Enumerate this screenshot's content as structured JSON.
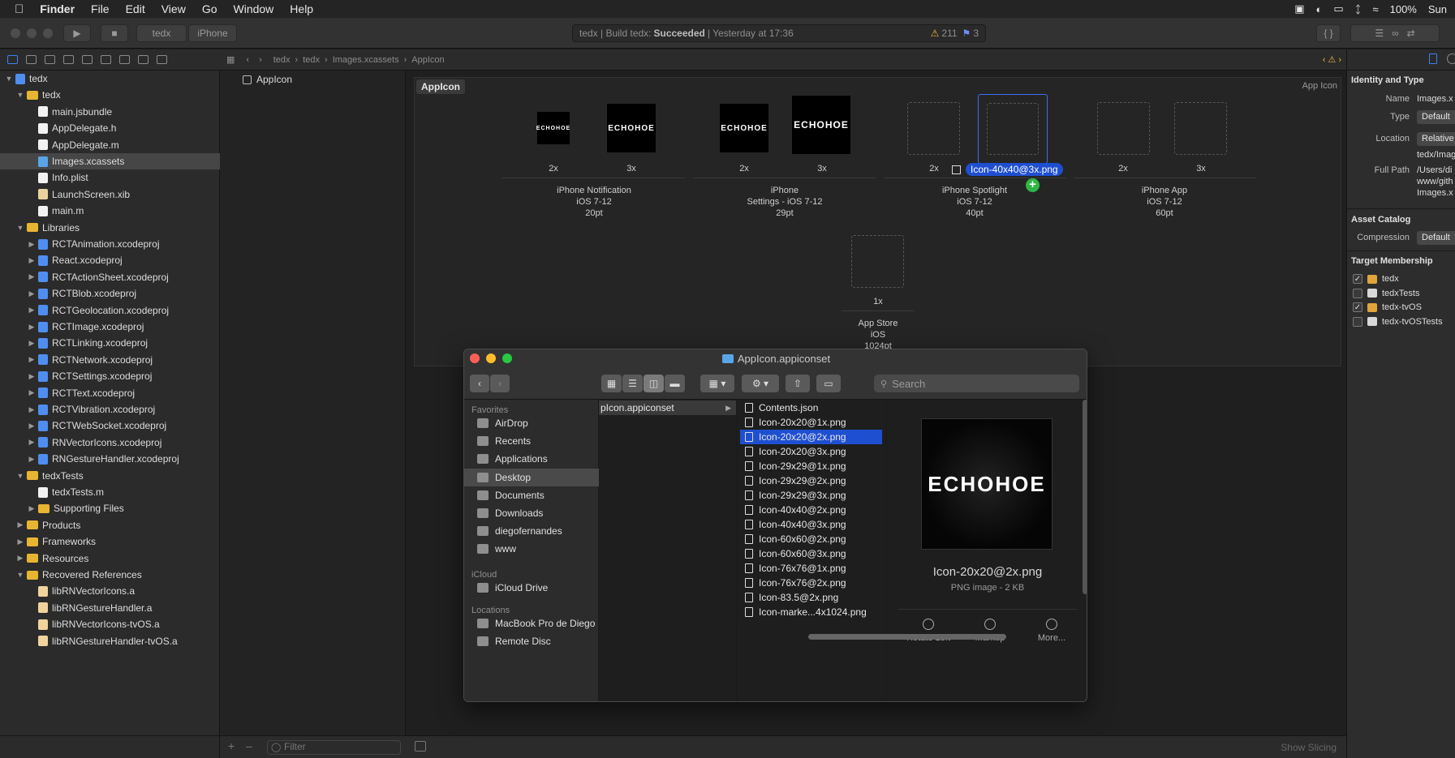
{
  "menubar": {
    "app": "Finder",
    "items": [
      "File",
      "Edit",
      "View",
      "Go",
      "Window",
      "Help"
    ],
    "battery": "100%",
    "clock": "Sun"
  },
  "xcode": {
    "scheme": "tedx",
    "device": "iPhone",
    "activity": {
      "prefix": "tedx | Build tedx:",
      "status": "Succeeded",
      "time": "| Yesterday at 17:36",
      "warnings": "211",
      "issues": "3"
    },
    "jumpbar": [
      "tedx",
      "tedx",
      "Images.xcassets",
      "AppIcon"
    ],
    "navigator": [
      {
        "label": "tedx",
        "indent": 0,
        "tri": "▼",
        "icon": "proj"
      },
      {
        "label": "tedx",
        "indent": 1,
        "tri": "▼",
        "icon": "folder"
      },
      {
        "label": "main.jsbundle",
        "indent": 2,
        "tri": "",
        "icon": "file"
      },
      {
        "label": "AppDelegate.h",
        "indent": 2,
        "tri": "",
        "icon": "file"
      },
      {
        "label": "AppDelegate.m",
        "indent": 2,
        "tri": "",
        "icon": "file"
      },
      {
        "label": "Images.xcassets",
        "indent": 2,
        "tri": "",
        "icon": "asset",
        "sel": true
      },
      {
        "label": "Info.plist",
        "indent": 2,
        "tri": "",
        "icon": "plist"
      },
      {
        "label": "LaunchScreen.xib",
        "indent": 2,
        "tri": "",
        "icon": "xib"
      },
      {
        "label": "main.m",
        "indent": 2,
        "tri": "",
        "icon": "file"
      },
      {
        "label": "Libraries",
        "indent": 1,
        "tri": "▼",
        "icon": "folder"
      },
      {
        "label": "RCTAnimation.xcodeproj",
        "indent": 2,
        "tri": "▶",
        "icon": "proj"
      },
      {
        "label": "React.xcodeproj",
        "indent": 2,
        "tri": "▶",
        "icon": "proj"
      },
      {
        "label": "RCTActionSheet.xcodeproj",
        "indent": 2,
        "tri": "▶",
        "icon": "proj"
      },
      {
        "label": "RCTBlob.xcodeproj",
        "indent": 2,
        "tri": "▶",
        "icon": "proj"
      },
      {
        "label": "RCTGeolocation.xcodeproj",
        "indent": 2,
        "tri": "▶",
        "icon": "proj"
      },
      {
        "label": "RCTImage.xcodeproj",
        "indent": 2,
        "tri": "▶",
        "icon": "proj"
      },
      {
        "label": "RCTLinking.xcodeproj",
        "indent": 2,
        "tri": "▶",
        "icon": "proj"
      },
      {
        "label": "RCTNetwork.xcodeproj",
        "indent": 2,
        "tri": "▶",
        "icon": "proj"
      },
      {
        "label": "RCTSettings.xcodeproj",
        "indent": 2,
        "tri": "▶",
        "icon": "proj"
      },
      {
        "label": "RCTText.xcodeproj",
        "indent": 2,
        "tri": "▶",
        "icon": "proj"
      },
      {
        "label": "RCTVibration.xcodeproj",
        "indent": 2,
        "tri": "▶",
        "icon": "proj"
      },
      {
        "label": "RCTWebSocket.xcodeproj",
        "indent": 2,
        "tri": "▶",
        "icon": "proj"
      },
      {
        "label": "RNVectorIcons.xcodeproj",
        "indent": 2,
        "tri": "▶",
        "icon": "proj"
      },
      {
        "label": "RNGestureHandler.xcodeproj",
        "indent": 2,
        "tri": "▶",
        "icon": "proj"
      },
      {
        "label": "tedxTests",
        "indent": 1,
        "tri": "▼",
        "icon": "folder"
      },
      {
        "label": "tedxTests.m",
        "indent": 2,
        "tri": "",
        "icon": "file"
      },
      {
        "label": "Supporting Files",
        "indent": 2,
        "tri": "▶",
        "icon": "folder"
      },
      {
        "label": "Products",
        "indent": 1,
        "tri": "▶",
        "icon": "folder"
      },
      {
        "label": "Frameworks",
        "indent": 1,
        "tri": "▶",
        "icon": "folder"
      },
      {
        "label": "Resources",
        "indent": 1,
        "tri": "▶",
        "icon": "folder"
      },
      {
        "label": "Recovered References",
        "indent": 1,
        "tri": "▼",
        "icon": "folder"
      },
      {
        "label": "libRNVectorIcons.a",
        "indent": 2,
        "tri": "",
        "icon": "lib"
      },
      {
        "label": "libRNGestureHandler.a",
        "indent": 2,
        "tri": "",
        "icon": "lib"
      },
      {
        "label": "libRNVectorIcons-tvOS.a",
        "indent": 2,
        "tri": "",
        "icon": "lib"
      },
      {
        "label": "libRNGestureHandler-tvOS.a",
        "indent": 2,
        "tri": "",
        "icon": "lib"
      }
    ],
    "asset_list": [
      "AppIcon"
    ],
    "filter_placeholder": "Filter",
    "editor": {
      "title": "AppIcon",
      "kind": "App Icon",
      "icon_text": "ECHOHOE",
      "drag_label": "Icon-40x40@3x.png",
      "groups": [
        {
          "name": "iPhone Notification",
          "os": "iOS 7-12",
          "size": "20pt",
          "scales": [
            "2x",
            "3x"
          ]
        },
        {
          "name": "iPhone",
          "os": "Settings - iOS 7-12",
          "size": "29pt",
          "scales": [
            "2x",
            "3x"
          ]
        },
        {
          "name": "iPhone Spotlight",
          "os": "iOS 7-12",
          "size": "40pt",
          "scales": [
            "2x",
            ""
          ]
        },
        {
          "name": "iPhone App",
          "os": "iOS 7-12",
          "size": "60pt",
          "scales": [
            "2x",
            "3x"
          ]
        },
        {
          "name": "App Store",
          "os": "iOS",
          "size": "1024pt",
          "scales": [
            "1x"
          ]
        }
      ],
      "show_slicing": "Show Slicing"
    },
    "inspector": {
      "identity_header": "Identity and Type",
      "name_label": "Name",
      "name_value": "Images.x",
      "type_label": "Type",
      "type_value": "Default",
      "location_label": "Location",
      "location_value": "Relative",
      "location_path": "tedx/Imag",
      "fullpath_label": "Full Path",
      "fullpath_value": [
        "/Users/di",
        "www/gith",
        "Images.x"
      ],
      "catalog_header": "Asset Catalog",
      "compression_label": "Compression",
      "compression_value": "Default",
      "membership_header": "Target Membership",
      "targets": [
        {
          "name": "tedx",
          "checked": true
        },
        {
          "name": "tedxTests",
          "checked": false
        },
        {
          "name": "tedx-tvOS",
          "checked": true
        },
        {
          "name": "tedx-tvOSTests",
          "checked": false
        }
      ]
    }
  },
  "finder": {
    "title": "AppIcon.appiconset",
    "search_placeholder": "Search",
    "favorites_header": "Favorites",
    "favorites": [
      "AirDrop",
      "Recents",
      "Applications",
      "Desktop",
      "Documents",
      "Downloads",
      "diegofernandes",
      "www"
    ],
    "selected_favorite": "Desktop",
    "icloud_header": "iCloud",
    "icloud": [
      "iCloud Drive"
    ],
    "locations_header": "Locations",
    "locations": [
      "MacBook Pro de Diego",
      "Remote Disc"
    ],
    "column1": "pIcon.appiconset",
    "files": [
      "Contents.json",
      "Icon-20x20@1x.png",
      "Icon-20x20@2x.png",
      "Icon-20x20@3x.png",
      "Icon-29x29@1x.png",
      "Icon-29x29@2x.png",
      "Icon-29x29@3x.png",
      "Icon-40x40@2x.png",
      "Icon-40x40@3x.png",
      "Icon-60x60@2x.png",
      "Icon-60x60@3x.png",
      "Icon-76x76@1x.png",
      "Icon-76x76@2x.png",
      "Icon-83.5@2x.png",
      "Icon-marke...4x1024.png"
    ],
    "selected_file": "Icon-20x20@2x.png",
    "preview": {
      "name": "Icon-20x20@2x.png",
      "info": "PNG image - 2 KB",
      "text": "ECHOHOE"
    },
    "actions": [
      "Rotate Left",
      "Markup",
      "More..."
    ]
  }
}
